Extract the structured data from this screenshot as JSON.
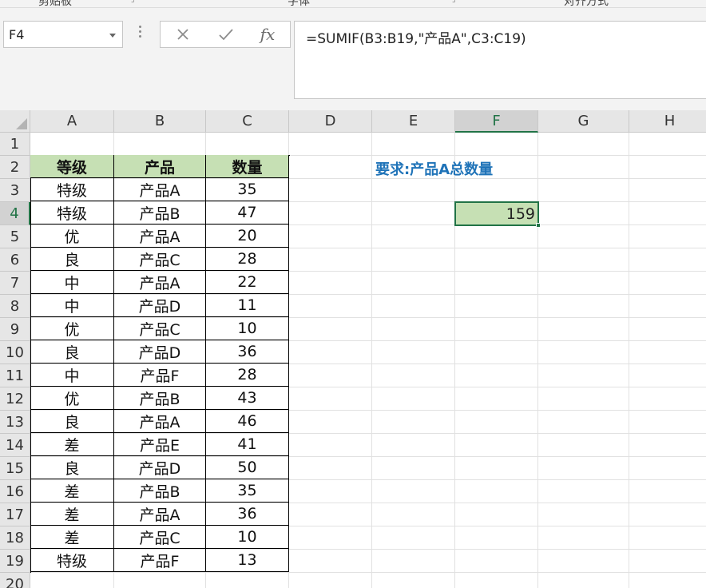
{
  "name_box": {
    "value": "F4"
  },
  "formula_bar": {
    "cancel_icon": "cross-icon",
    "enter_icon": "check-icon",
    "fx_label": "fx",
    "formula": "=SUMIF(B3:B19,\"产品A\",C3:C19)"
  },
  "columns": [
    "A",
    "B",
    "C",
    "D",
    "E",
    "F",
    "G",
    "H"
  ],
  "rows": [
    "1",
    "2",
    "3",
    "4",
    "5",
    "6",
    "7",
    "8",
    "9",
    "10",
    "11",
    "12",
    "13",
    "14",
    "15",
    "16",
    "17",
    "18",
    "19",
    "20"
  ],
  "table": {
    "headers": [
      "等级",
      "产品",
      "数量"
    ],
    "data": [
      [
        "特级",
        "产品A",
        "35"
      ],
      [
        "特级",
        "产品B",
        "47"
      ],
      [
        "优",
        "产品A",
        "20"
      ],
      [
        "良",
        "产品C",
        "28"
      ],
      [
        "中",
        "产品A",
        "22"
      ],
      [
        "中",
        "产品D",
        "11"
      ],
      [
        "优",
        "产品C",
        "10"
      ],
      [
        "良",
        "产品D",
        "36"
      ],
      [
        "中",
        "产品F",
        "28"
      ],
      [
        "优",
        "产品B",
        "43"
      ],
      [
        "良",
        "产品A",
        "46"
      ],
      [
        "差",
        "产品E",
        "41"
      ],
      [
        "良",
        "产品D",
        "50"
      ],
      [
        "差",
        "产品B",
        "35"
      ],
      [
        "差",
        "产品A",
        "36"
      ],
      [
        "差",
        "产品C",
        "10"
      ],
      [
        "特级",
        "产品F",
        "13"
      ]
    ]
  },
  "requirement_text": "要求:产品A总数量",
  "result_value": "159",
  "colors": {
    "accent": "#217346",
    "header_fill": "#c6e0b4",
    "requirement_text": "#1f73b8"
  }
}
